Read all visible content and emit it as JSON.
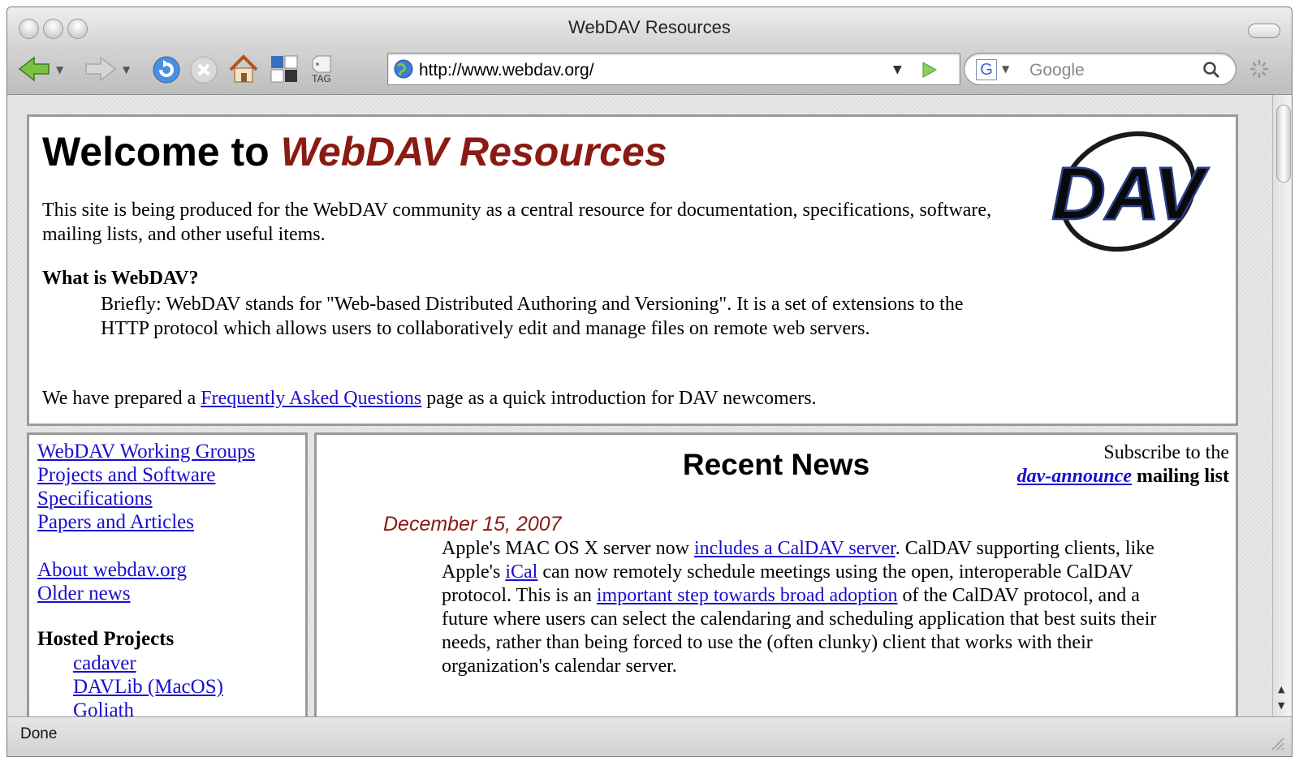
{
  "window": {
    "title": "WebDAV Resources"
  },
  "toolbar": {
    "url": "http://www.webdav.org/",
    "search_placeholder": "Google",
    "icons": [
      "back-arrow-icon",
      "forward-arrow-icon",
      "reload-icon",
      "stop-icon",
      "home-icon",
      "bookmark-icon",
      "tag-icon",
      "globe-icon",
      "go-arrow-icon",
      "google-icon",
      "magnifier-icon",
      "spinner-icon"
    ],
    "tag_label": "TAG"
  },
  "header_panel": {
    "welcome_prefix": "Welcome to",
    "welcome_brand": "WebDAV Resources",
    "intro": "This site is being produced for the WebDAV community as a central resource for documentation, specifications, software, mailing lists, and other useful items.",
    "what_heading": "What is WebDAV?",
    "what_body": "Briefly: WebDAV stands for \"Web-based Distributed Authoring and Versioning\". It is a set of extensions to the HTTP protocol which allows users to collaboratively edit and manage files on remote web servers.",
    "faq_before": "We have prepared a",
    "faq_link": "Frequently Asked Questions",
    "faq_after": "page as a quick introduction for DAV newcomers.",
    "logo_text": "DAV"
  },
  "sidebar": {
    "links_primary": [
      "WebDAV Working Groups",
      "Projects and Software",
      "Specifications",
      "Papers and Articles"
    ],
    "links_secondary": [
      "About webdav.org",
      "Older news"
    ],
    "hosted_heading": "Hosted Projects",
    "hosted_links": [
      "cadaver",
      "DAVLib (MacOS)",
      "Goliath"
    ]
  },
  "news": {
    "heading": "Recent News",
    "subscribe_prefix": "Subscribe to the",
    "subscribe_link": "dav-announce",
    "subscribe_suffix": "mailing list",
    "date": "December 15, 2007",
    "p1": "Apple's MAC OS X server now",
    "l1": "includes a CalDAV server",
    "p2": ". CalDAV supporting clients, like Apple's",
    "l2": "iCal",
    "p3": "can now remotely schedule meetings using the open, interoperable CalDAV protocol. This is an",
    "l3": "important step towards broad adoption",
    "p4": "of the CalDAV protocol, and a future where users can select the calendaring and scheduling application that best suits their needs, rather than being forced to use the (often clunky) client that works with their organization's calendar server."
  },
  "status": {
    "text": "Done"
  }
}
